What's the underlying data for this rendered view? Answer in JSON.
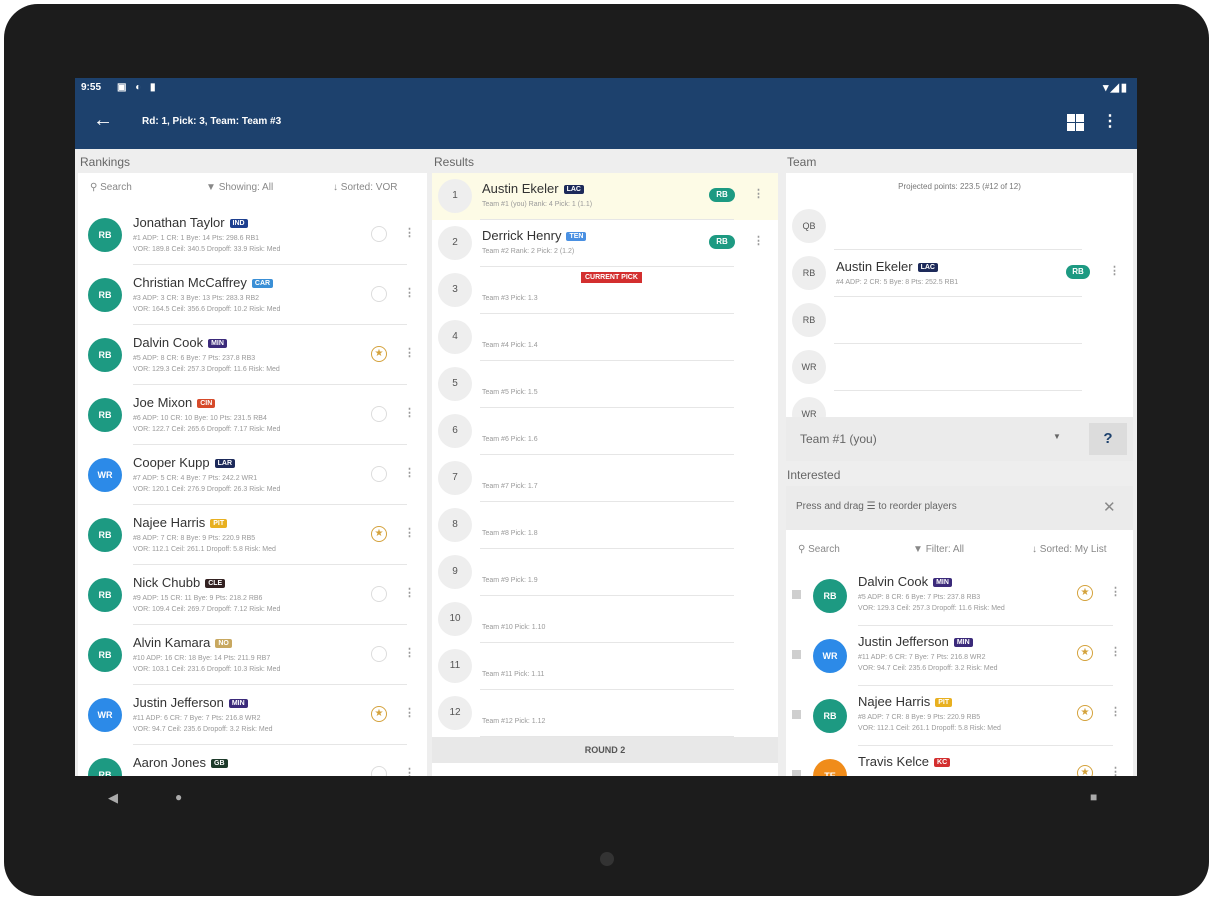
{
  "status_bar": {
    "time": "9:55",
    "left_icons": "▣ ◐ ▮",
    "right_icons": "▾◢▮"
  },
  "app_bar": {
    "title": "Rd: 1, Pick: 3, Team: Team #3"
  },
  "columns": {
    "rankings": "Rankings",
    "results": "Results",
    "team": "Team"
  },
  "rankings": {
    "search": "Search",
    "showing": "Showing: All",
    "sorted": "Sorted: VOR",
    "players": [
      {
        "pos": "RB",
        "color": "#1d9a82",
        "name": "Jonathan Taylor",
        "team": "IND",
        "team_color": "#1d3f8f",
        "line1": "#1   ADP: 1   CR: 1   Bye: 14   Pts: 298.6   RB1",
        "line2": "VOR: 189.8   Ceil: 340.5   Dropoff: 33.9   Risk: Med",
        "starred": false
      },
      {
        "pos": "RB",
        "color": "#1d9a82",
        "name": "Christian McCaffrey",
        "team": "CAR",
        "team_color": "#3a8fd6",
        "line1": "#3   ADP: 3   CR: 3   Bye: 13   Pts: 283.3   RB2",
        "line2": "VOR: 164.5   Ceil: 356.6   Dropoff: 10.2   Risk: Med",
        "starred": false
      },
      {
        "pos": "RB",
        "color": "#1d9a82",
        "name": "Dalvin Cook",
        "team": "MIN",
        "team_color": "#3b2a7a",
        "line1": "#5   ADP: 8   CR: 6   Bye: 7   Pts: 237.8   RB3",
        "line2": "VOR: 129.3   Ceil: 257.3   Dropoff: 11.6   Risk: Med",
        "starred": true
      },
      {
        "pos": "RB",
        "color": "#1d9a82",
        "name": "Joe Mixon",
        "team": "CIN",
        "team_color": "#d64a2a",
        "line1": "#6   ADP: 10   CR: 10   Bye: 10   Pts: 231.5   RB4",
        "line2": "VOR: 122.7   Ceil: 265.6   Dropoff: 7.17   Risk: Med",
        "starred": false
      },
      {
        "pos": "WR",
        "color": "#2c8ae8",
        "name": "Cooper Kupp",
        "team": "LAR",
        "team_color": "#1d2a5a",
        "line1": "#7   ADP: 5   CR: 4   Bye: 7   Pts: 242.2   WR1",
        "line2": "VOR: 120.1   Ceil: 276.9   Dropoff: 26.3   Risk: Med",
        "starred": false
      },
      {
        "pos": "RB",
        "color": "#1d9a82",
        "name": "Najee Harris",
        "team": "PIT",
        "team_color": "#e8b020",
        "line1": "#8   ADP: 7   CR: 8   Bye: 9   Pts: 220.9   RB5",
        "line2": "VOR: 112.1   Ceil: 261.1   Dropoff: 5.8   Risk: Med",
        "starred": true
      },
      {
        "pos": "RB",
        "color": "#1d9a82",
        "name": "Nick Chubb",
        "team": "CLE",
        "team_color": "#332222",
        "line1": "#9   ADP: 15   CR: 11   Bye: 9   Pts: 218.2   RB6",
        "line2": "VOR: 109.4   Ceil: 269.7   Dropoff: 7.12   Risk: Med",
        "starred": false
      },
      {
        "pos": "RB",
        "color": "#1d9a82",
        "name": "Alvin Kamara",
        "team": "NO",
        "team_color": "#c8a860",
        "line1": "#10   ADP: 16   CR: 18   Bye: 14   Pts: 211.9   RB7",
        "line2": "VOR: 103.1   Ceil: 231.6   Dropoff: 10.3   Risk: Med",
        "starred": false
      },
      {
        "pos": "WR",
        "color": "#2c8ae8",
        "name": "Justin Jefferson",
        "team": "MIN",
        "team_color": "#3b2a7a",
        "line1": "#11   ADP: 6   CR: 7   Bye: 7   Pts: 216.8   WR2",
        "line2": "VOR: 94.7   Ceil: 235.6   Dropoff: 3.2   Risk: Med",
        "starred": true
      },
      {
        "pos": "RB",
        "color": "#1d9a82",
        "name": "Aaron Jones",
        "team": "GB",
        "team_color": "#1d3a2a",
        "line1": "",
        "line2": "",
        "starred": false
      }
    ]
  },
  "results": {
    "picks": [
      {
        "num": "1",
        "name": "Austin Ekeler",
        "team": "LAC",
        "team_color": "#1d2a5a",
        "line": "Team #1 (you)   Rank: 4   Pick: 1 (1.1)",
        "pos": "RB",
        "highlight": true
      },
      {
        "num": "2",
        "name": "Derrick Henry",
        "team": "TEN",
        "team_color": "#4a90e2",
        "line": "Team #2   Rank: 2   Pick: 2 (1.2)",
        "pos": "RB",
        "highlight": false
      },
      {
        "num": "3",
        "team_label": "Team #3   Pick: 1.3",
        "current": "CURRENT PICK"
      },
      {
        "num": "4",
        "team_label": "Team #4   Pick: 1.4"
      },
      {
        "num": "5",
        "team_label": "Team #5   Pick: 1.5"
      },
      {
        "num": "6",
        "team_label": "Team #6   Pick: 1.6"
      },
      {
        "num": "7",
        "team_label": "Team #7   Pick: 1.7"
      },
      {
        "num": "8",
        "team_label": "Team #8   Pick: 1.8"
      },
      {
        "num": "9",
        "team_label": "Team #9   Pick: 1.9"
      },
      {
        "num": "10",
        "team_label": "Team #10   Pick: 1.10"
      },
      {
        "num": "11",
        "team_label": "Team #11   Pick: 1.11"
      },
      {
        "num": "12",
        "team_label": "Team #12   Pick: 1.12"
      }
    ],
    "round_label": "ROUND 2"
  },
  "team": {
    "projected": "Projected points: 223.5 (#12 of 12)",
    "slots": [
      {
        "pos": "QB"
      },
      {
        "pos": "RB",
        "name": "Austin Ekeler",
        "team": "LAC",
        "team_color": "#1d2a5a",
        "line": "#4   ADP: 2   CR: 5   Bye: 8   Pts: 252.5   RB1",
        "pill": "RB"
      },
      {
        "pos": "RB"
      },
      {
        "pos": "WR"
      },
      {
        "pos": "WR"
      }
    ],
    "selector": "Team #1 (you)",
    "help": "?"
  },
  "interested": {
    "header": "Interested",
    "hint": "Press and drag ☰ to reorder players",
    "close": "✕",
    "search": "Search",
    "filter": "Filter: All",
    "sorted": "Sorted: My List",
    "players": [
      {
        "pos": "RB",
        "color": "#1d9a82",
        "name": "Dalvin Cook",
        "team": "MIN",
        "team_color": "#3b2a7a",
        "line1": "#5   ADP: 8   CR: 6   Bye: 7   Pts: 237.8   RB3",
        "line2": "VOR: 129.3   Ceil: 257.3   Dropoff: 11.6   Risk: Med"
      },
      {
        "pos": "WR",
        "color": "#2c8ae8",
        "name": "Justin Jefferson",
        "team": "MIN",
        "team_color": "#3b2a7a",
        "line1": "#11   ADP: 6   CR: 7   Bye: 7   Pts: 216.8   WR2",
        "line2": "VOR: 94.7   Ceil: 235.6   Dropoff: 3.2   Risk: Med"
      },
      {
        "pos": "RB",
        "color": "#1d9a82",
        "name": "Najee Harris",
        "team": "PIT",
        "team_color": "#e8b020",
        "line1": "#8   ADP: 7   CR: 8   Bye: 9   Pts: 220.9   RB5",
        "line2": "VOR: 112.1   Ceil: 261.1   Dropoff: 5.8   Risk: Med"
      },
      {
        "pos": "TE",
        "color": "#f08c1a",
        "name": "Travis Kelce",
        "team": "KC",
        "team_color": "#d32f2f",
        "line1": "",
        "line2": ""
      }
    ]
  },
  "nav": {
    "back": "◀",
    "home": "●",
    "recents": "■"
  }
}
